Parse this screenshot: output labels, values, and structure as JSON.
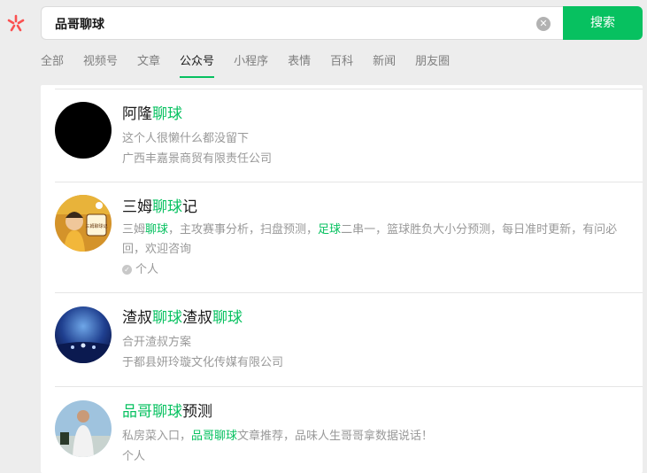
{
  "search": {
    "value": "品哥聊球",
    "button_label": "搜索"
  },
  "tabs": [
    {
      "label": "全部",
      "active": false
    },
    {
      "label": "视频号",
      "active": false
    },
    {
      "label": "文章",
      "active": false
    },
    {
      "label": "公众号",
      "active": true
    },
    {
      "label": "小程序",
      "active": false
    },
    {
      "label": "表情",
      "active": false
    },
    {
      "label": "百科",
      "active": false
    },
    {
      "label": "新闻",
      "active": false
    },
    {
      "label": "朋友圈",
      "active": false
    }
  ],
  "accent_color": "#07c160",
  "results": [
    {
      "title_parts": [
        "阿隆",
        "聊球"
      ],
      "desc": "这个人很懒什么都没留下",
      "sub": "广西丰嘉景商贸有限责任公司"
    },
    {
      "title_parts": [
        "三姆",
        "聊球",
        "记"
      ],
      "desc_parts": [
        "三姆",
        "聊球",
        "，主攻赛事分析，扫盘预测，",
        "足球",
        "二串一，篮球胜负大小分预测，每日准时更新，有问必回，欢迎咨询"
      ],
      "sub": "个人",
      "avatar_text": "三姆聊球记"
    },
    {
      "title_parts": [
        "渣叔",
        "聊球",
        "渣叔",
        "聊球"
      ],
      "desc": "合开渣叔方案",
      "sub": "于都县妍玲璇文化传媒有限公司"
    },
    {
      "title_parts": [
        "品哥聊球",
        "预测"
      ],
      "desc_parts": [
        "私房菜入口，",
        "品哥聊球",
        "文章推荐，品味人生哥哥拿数据说话！"
      ],
      "sub": "个人"
    }
  ]
}
